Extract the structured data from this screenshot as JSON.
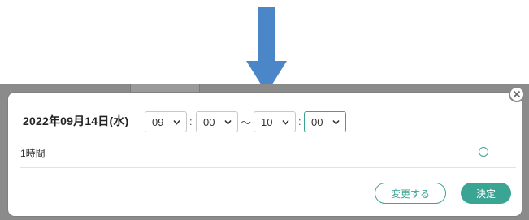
{
  "modal": {
    "date_label": "2022年09月14日(水)",
    "start_hour": "09",
    "start_minute": "00",
    "range_separator": "〜",
    "end_hour": "10",
    "end_minute": "00",
    "colon": ":",
    "duration_option": "1時間",
    "change_button": "変更する",
    "decide_button": "決定"
  },
  "colors": {
    "accent": "#3aa593",
    "arrow": "#4a86c8",
    "backdrop": "#8b8b8b"
  },
  "icons": [
    "down-arrow-icon",
    "close-icon",
    "chevron-down-icon",
    "radio-icon"
  ]
}
